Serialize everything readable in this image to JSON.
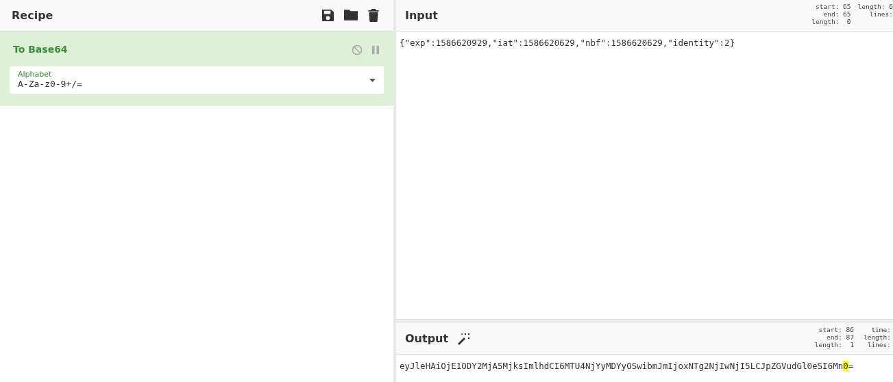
{
  "recipe": {
    "title": "Recipe",
    "operations": [
      {
        "name": "To Base64",
        "disabled": false,
        "paused": false,
        "args": [
          {
            "label": "Alphabet",
            "value": "A-Za-z0-9+/="
          }
        ]
      }
    ]
  },
  "input": {
    "title": "Input",
    "stats": [
      [
        "start: 65",
        "end: 65",
        "length:  0"
      ],
      [
        "length: 6",
        "lines:"
      ]
    ],
    "text": "{\"exp\":1586620929,\"iat\":1586620629,\"nbf\":1586620629,\"identity\":2}"
  },
  "output": {
    "title": "Output",
    "stats": [
      [
        "start: 86",
        "end: 87",
        "length:  1"
      ],
      [
        "time:",
        "length:",
        "lines:"
      ]
    ],
    "text": "eyJleHAiOjE1ODY2MjA5MjksImlhdCI6MTU4NjYyMDYyOSwibmJmIjoxNTg2NjIwNjI5LCJpZGVudGl0eSI6Mn",
    "selected_text": "0",
    "text_after": "="
  }
}
